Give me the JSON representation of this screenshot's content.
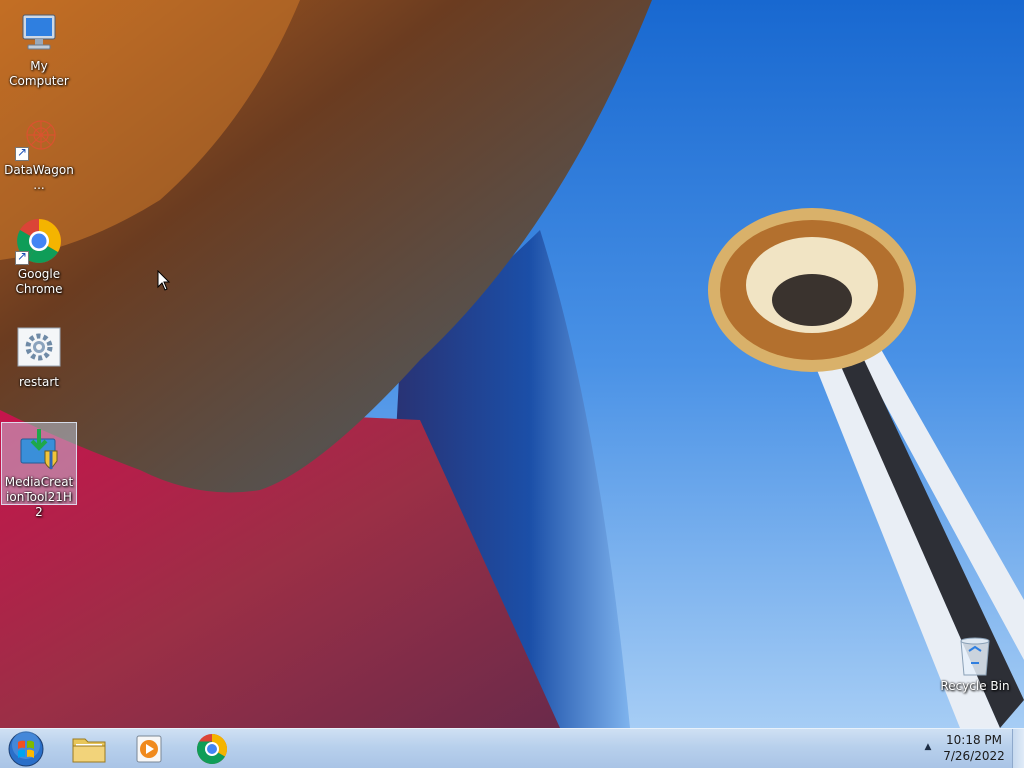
{
  "desktop": {
    "icons": [
      {
        "label": "My Computer",
        "icon": "computer-icon",
        "shortcut": false,
        "selected": false
      },
      {
        "label": "DataWagon...",
        "icon": "datawagon-icon",
        "shortcut": true,
        "selected": false
      },
      {
        "label": "Google Chrome",
        "icon": "chrome-icon",
        "shortcut": true,
        "selected": false
      },
      {
        "label": "restart",
        "icon": "settings-gear-icon",
        "shortcut": false,
        "selected": false
      },
      {
        "label": "MediaCreationTool21H2",
        "icon": "media-creation-tool-icon",
        "shortcut": false,
        "selected": true
      }
    ],
    "recycle_bin": {
      "label": "Recycle Bin",
      "icon": "recycle-bin-icon"
    }
  },
  "taskbar": {
    "start_icon": "windows-start-orb-icon",
    "pinned": [
      {
        "name": "File Explorer",
        "icon": "folder-icon"
      },
      {
        "name": "Windows Media Player",
        "icon": "media-player-icon"
      },
      {
        "name": "Google Chrome",
        "icon": "chrome-icon"
      }
    ],
    "tray_arrow": "▲",
    "clock": {
      "time": "10:18 PM",
      "date": "7/26/2022"
    }
  },
  "colors": {
    "taskbar": "#b8d0ec",
    "sky": "#3c8ae8",
    "selection": "#c8dcf5"
  }
}
